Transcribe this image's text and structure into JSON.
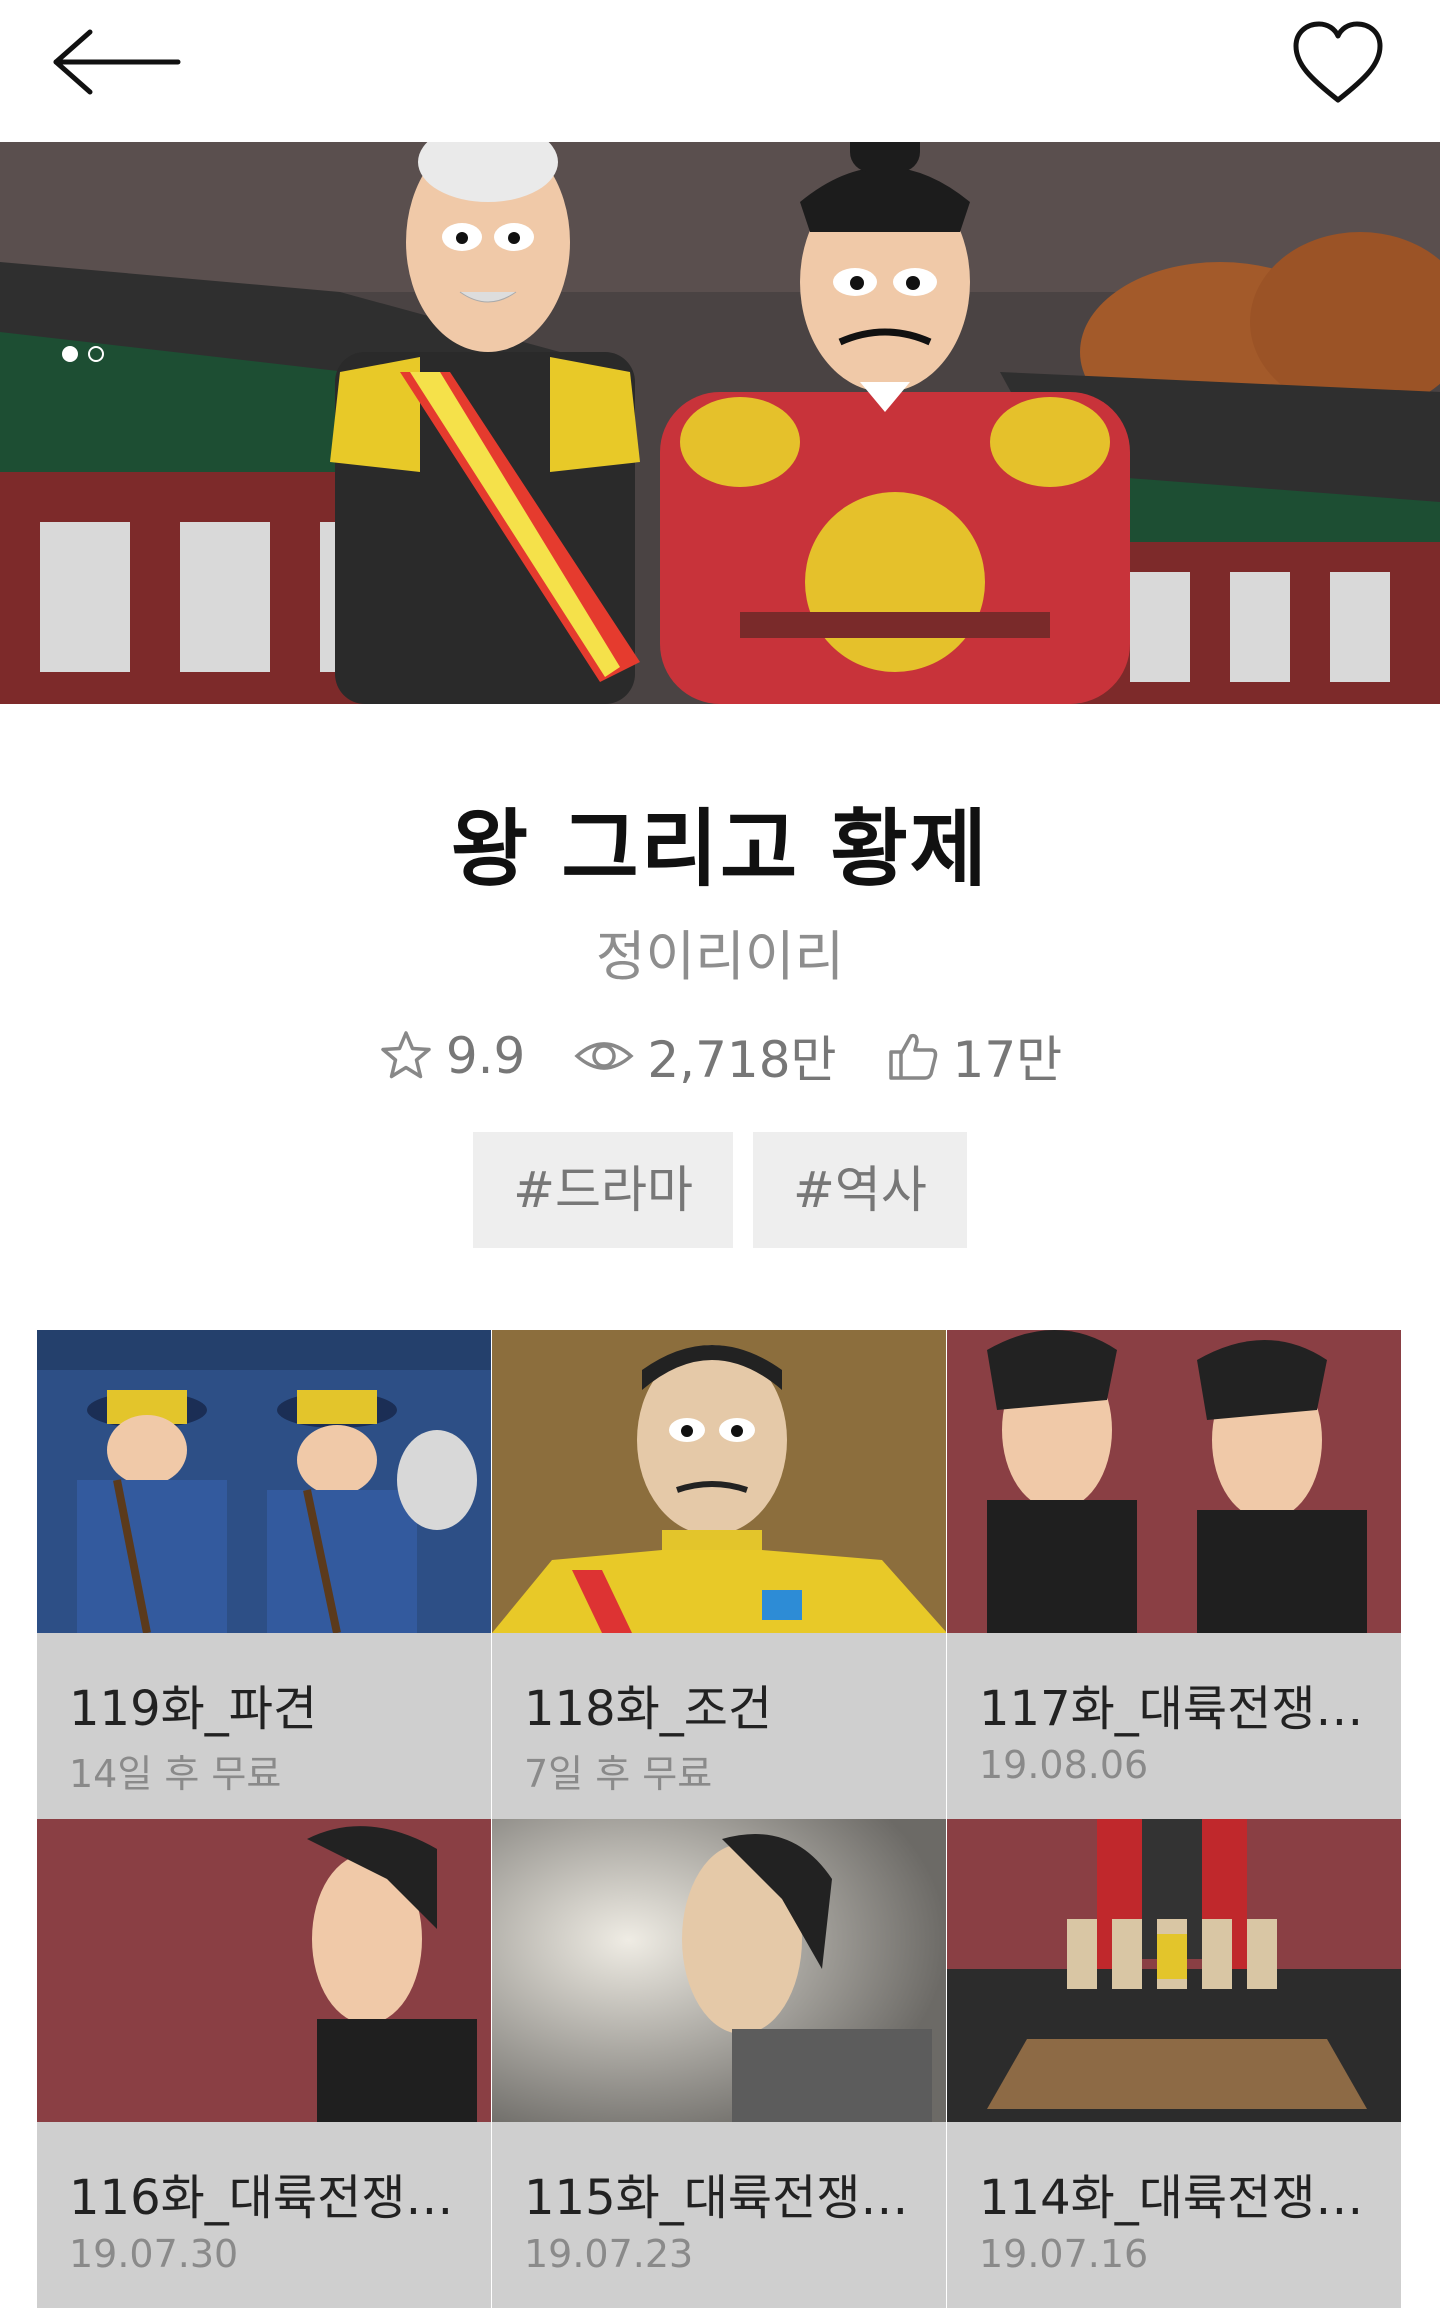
{
  "header": {
    "back_icon": "arrow-left-icon",
    "favorite_icon": "heart-outline-icon"
  },
  "hero": {
    "slide_count": 2,
    "active_slide": 1
  },
  "title": "왕 그리고 황제",
  "author": "정이리이리",
  "stats": {
    "rating": "9.9",
    "views": "2,718만",
    "likes": "17만"
  },
  "tags": [
    "#드라마",
    "#역사"
  ],
  "episodes": [
    {
      "title": "119화_파견",
      "sub": "14일 후 무료",
      "thumb_bg": "#2d4f86"
    },
    {
      "title": "118화_조건",
      "sub": "7일 후 무료",
      "thumb_bg": "#8c6e3d"
    },
    {
      "title": "117화_대륙전쟁(…",
      "sub": "19.08.06",
      "thumb_bg": "#8a3f44"
    },
    {
      "title": "116화_대륙전쟁(…",
      "sub": "19.07.30",
      "thumb_bg": "#8a3f44"
    },
    {
      "title": "115화_대륙전쟁(…",
      "sub": "19.07.23",
      "thumb_bg": "#b7b3aa"
    },
    {
      "title": "114화_대륙전쟁(…",
      "sub": "19.07.16",
      "thumb_bg": "#8a3f44"
    }
  ]
}
